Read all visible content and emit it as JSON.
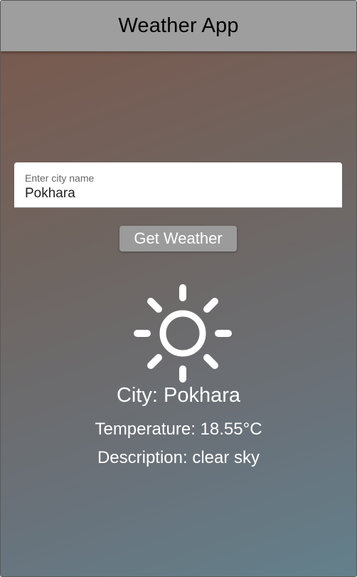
{
  "appbar": {
    "title": "Weather App"
  },
  "city_input": {
    "label": "Enter city name",
    "value": "Pokhara"
  },
  "actions": {
    "get_weather_label": "Get Weather"
  },
  "weather": {
    "icon": "sun-icon",
    "city_text": "City: Pokhara",
    "temperature_text": "Temperature: 18.55°C",
    "description_text": "Description: clear sky"
  },
  "colors": {
    "appbar": "#9e9e9e",
    "button": "#9b9b9b",
    "text_light": "#ffffff"
  }
}
